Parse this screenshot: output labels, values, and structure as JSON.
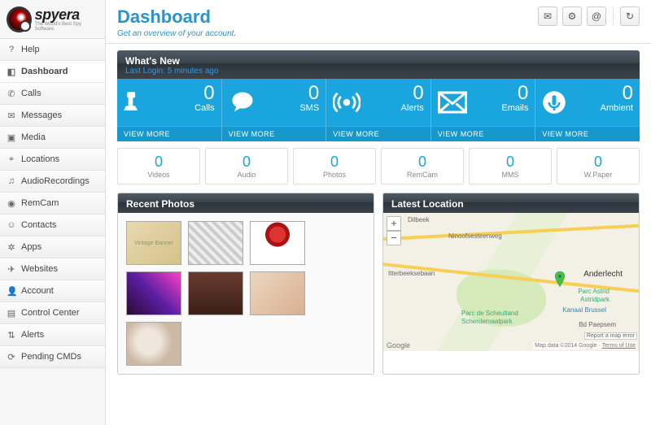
{
  "brand": {
    "name": "spyera",
    "tagline": "The World's Best Spy Software"
  },
  "nav": [
    {
      "label": "Help"
    },
    {
      "label": "Dashboard",
      "active": true
    },
    {
      "label": "Calls"
    },
    {
      "label": "Messages"
    },
    {
      "label": "Media"
    },
    {
      "label": "Locations"
    },
    {
      "label": "AudioRecordings"
    },
    {
      "label": "RemCam"
    },
    {
      "label": "Contacts"
    },
    {
      "label": "Apps"
    },
    {
      "label": "Websites"
    },
    {
      "label": "Account"
    },
    {
      "label": "Control Center"
    },
    {
      "label": "Alerts"
    },
    {
      "label": "Pending CMDs"
    }
  ],
  "header": {
    "title": "Dashboard",
    "subtitle": "Get an overview of your account."
  },
  "whats_new": {
    "title": "What's New",
    "last_login": "Last Login: 5 minutes ago"
  },
  "tiles": {
    "view_more": "VIEW MORE",
    "primary": [
      {
        "label": "Calls",
        "value": "0"
      },
      {
        "label": "SMS",
        "value": "0"
      },
      {
        "label": "Alerts",
        "value": "0"
      },
      {
        "label": "Emails",
        "value": "0"
      },
      {
        "label": "Ambient",
        "value": "0"
      }
    ],
    "secondary": [
      {
        "label": "Videos",
        "value": "0"
      },
      {
        "label": "Audio",
        "value": "0"
      },
      {
        "label": "Photos",
        "value": "0"
      },
      {
        "label": "RemCam",
        "value": "0"
      },
      {
        "label": "MMS",
        "value": "0"
      },
      {
        "label": "W.Paper",
        "value": "0"
      }
    ]
  },
  "panels": {
    "recent_photos": "Recent Photos",
    "latest_location": "Latest Location",
    "vintage_banner": "Vintage Banner"
  },
  "map": {
    "dilbeek": "Dilbeek",
    "ninoof": "Ninoofsesteenweg",
    "itterbeek": "Itterbeeksebaan",
    "anderlecht": "Anderlecht",
    "park1": "Parc Astrid",
    "park2": "Astridpark",
    "park3": "Parc de Scheutland",
    "park4": "Scherdemaalpark",
    "kanaal": "Kanaal Brussel",
    "bd": "Bd Paepsem",
    "google": "Google",
    "attrib": "Map data ©2014 Google ·",
    "terms": "Terms of Use",
    "report": "Report a map error"
  }
}
